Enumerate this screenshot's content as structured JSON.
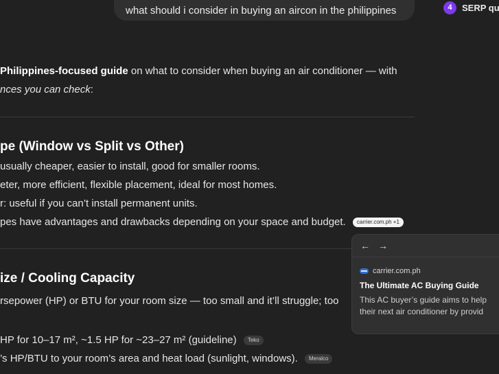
{
  "user_query": "what should i consider in buying an aircon in the philippines",
  "serp": {
    "count": "4",
    "label": "SERP que"
  },
  "intro": {
    "bold": "Philippines-focused guide",
    "rest": " on what to consider when buying an air conditioner — with",
    "line2": "nces you can check"
  },
  "section1": {
    "heading": "pe (Window vs Split vs Other)",
    "lines": [
      "usually cheaper, easier to install, good for smaller rooms.",
      "eter, more efficient, flexible placement, ideal for most homes.",
      "r: useful if you can’t install permanent units.",
      "pes have advantages and drawbacks depending on your space and budget."
    ],
    "citation": "carrier.com.ph +1"
  },
  "section2": {
    "heading": "ize / Cooling Capacity",
    "line1": "rsepower (HP) or BTU for your room size — too small and it’ll struggle; too",
    "line2": "HP for 10–17 m², ~1.5 HP for ~23–27 m² (guideline)",
    "cite2": "Teko",
    "line3": "’s HP/BTU to your room’s area and heat load (sunlight, windows).",
    "cite3": "Meralco"
  },
  "popover": {
    "back": "←",
    "forward": "→",
    "source": "carrier.com.ph",
    "title": "The Ultimate AC Buying Guide",
    "desc_line1": "This AC buyer’s guide aims to help",
    "desc_line2": "their next air conditioner by provid"
  }
}
